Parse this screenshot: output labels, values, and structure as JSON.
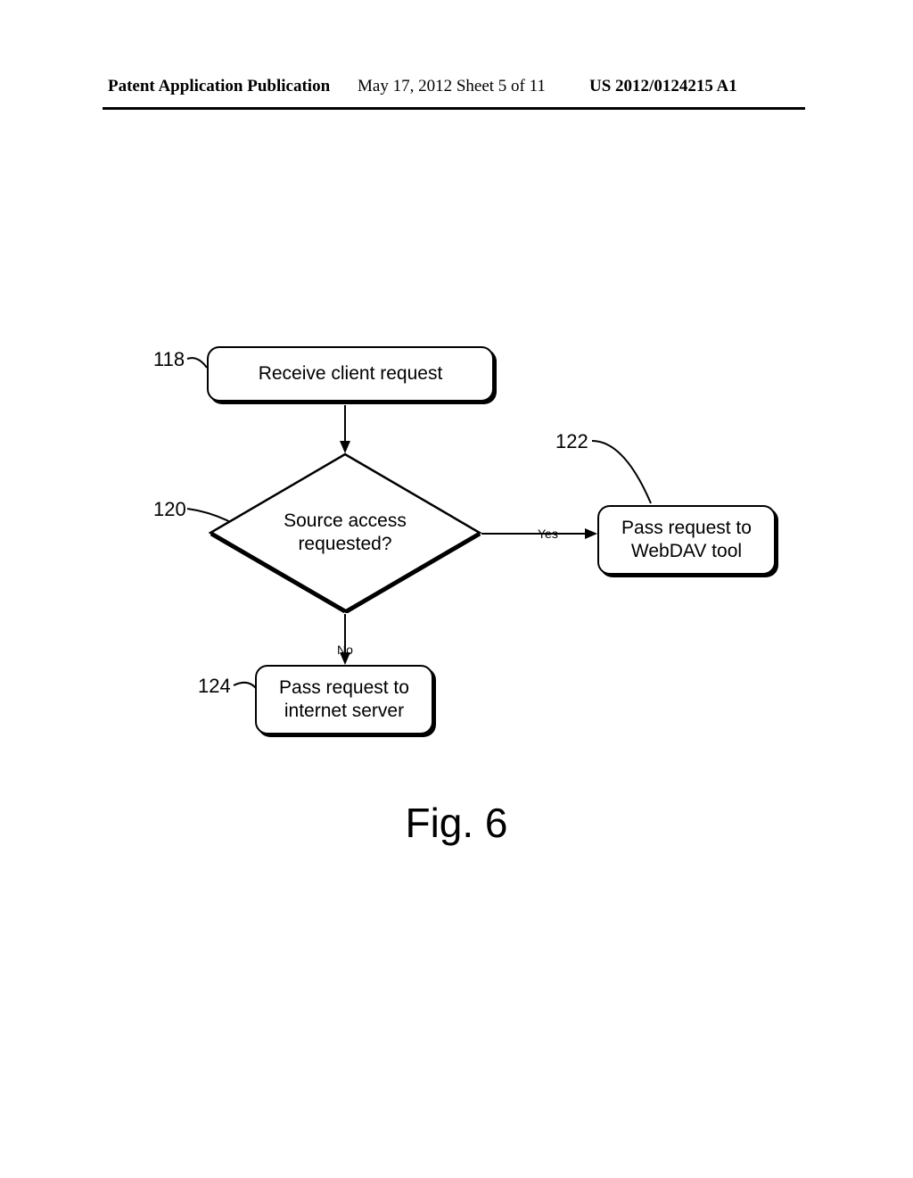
{
  "header": {
    "pub": "Patent Application Publication",
    "date": "May 17, 2012  Sheet 5 of 11",
    "pubno": "US 2012/0124215 A1"
  },
  "flow": {
    "ref118": "118",
    "ref120": "120",
    "ref122": "122",
    "ref124": "124",
    "box118": "Receive client request",
    "diamond120": "Source access\nrequested?",
    "box122": "Pass request to\nWebDAV tool",
    "box124": "Pass request to\ninternet server",
    "yes": "Yes",
    "no": "No"
  },
  "caption": "Fig. 6"
}
